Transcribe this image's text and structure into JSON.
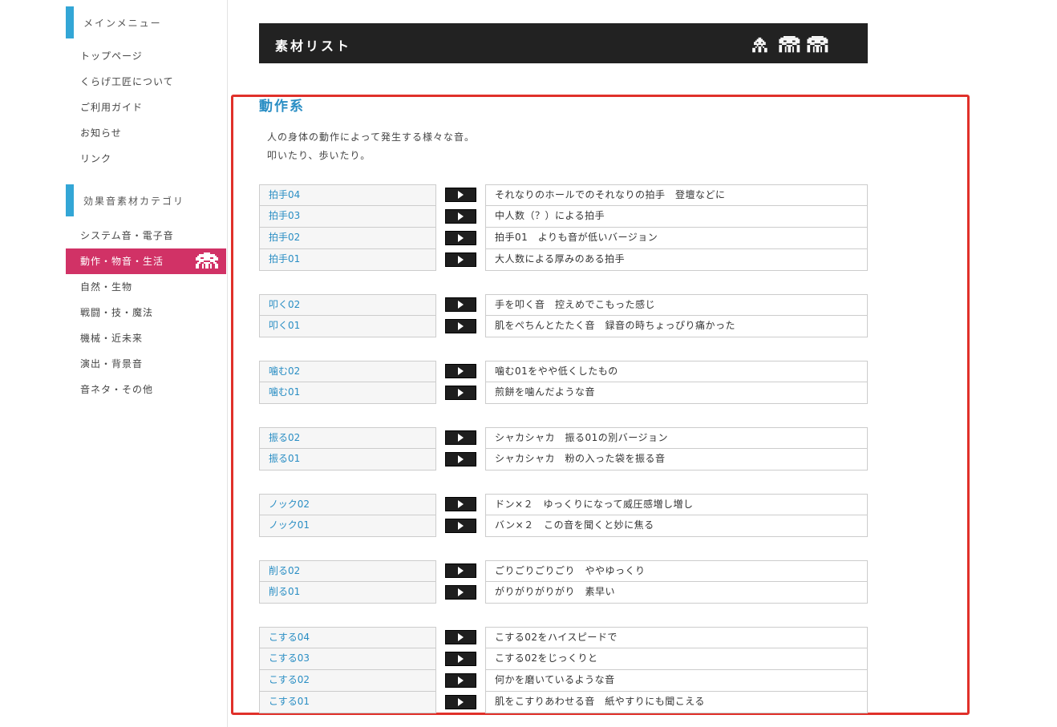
{
  "sidebar": {
    "main_menu": {
      "heading": "メインメニュー",
      "items": [
        {
          "label": "トップページ"
        },
        {
          "label": "くらげ工匠について"
        },
        {
          "label": "ご利用ガイド"
        },
        {
          "label": "お知らせ"
        },
        {
          "label": "リンク"
        }
      ]
    },
    "categories": {
      "heading": "効果音素材カテゴリ",
      "items": [
        {
          "label": "システム音・電子音"
        },
        {
          "label": "動作・物音・生活",
          "active": true
        },
        {
          "label": "自然・生物"
        },
        {
          "label": "戦闘・技・魔法"
        },
        {
          "label": "機械・近未来"
        },
        {
          "label": "演出・背景音"
        },
        {
          "label": "音ネタ・その他"
        }
      ]
    }
  },
  "header": {
    "title": "素材リスト",
    "icon": "space-invader-icon"
  },
  "category": {
    "title": "動作系",
    "desc_line1": "人の身体の動作によって発生する様々な音。",
    "desc_line2": "叩いたり、歩いたり。"
  },
  "colors": {
    "accent_blue": "#33a6d6",
    "active_pink": "#d13266",
    "link_blue": "#2a8ec4",
    "highlight_red": "#e0302a"
  },
  "groups": [
    {
      "sounds": [
        {
          "name": "拍手04",
          "desc": "それなりのホールでのそれなりの拍手　登壇などに"
        },
        {
          "name": "拍手03",
          "desc": "中人数（？）による拍手"
        },
        {
          "name": "拍手02",
          "desc": "拍手01　よりも音が低いバージョン"
        },
        {
          "name": "拍手01",
          "desc": "大人数による厚みのある拍手"
        }
      ]
    },
    {
      "sounds": [
        {
          "name": "叩く02",
          "desc": "手を叩く音　控えめでこもった感じ"
        },
        {
          "name": "叩く01",
          "desc": "肌をぺちんとたたく音　録音の時ちょっぴり痛かった"
        }
      ]
    },
    {
      "sounds": [
        {
          "name": "噛む02",
          "desc": "噛む01をやや低くしたもの"
        },
        {
          "name": "噛む01",
          "desc": "煎餅を噛んだような音"
        }
      ]
    },
    {
      "sounds": [
        {
          "name": "振る02",
          "desc": "シャカシャカ　振る01の別バージョン"
        },
        {
          "name": "振る01",
          "desc": "シャカシャカ　粉の入った袋を振る音"
        }
      ]
    },
    {
      "sounds": [
        {
          "name": "ノック02",
          "desc": "ドン×２　ゆっくりになって威圧感増し増し"
        },
        {
          "name": "ノック01",
          "desc": "バン×２　この音を聞くと妙に焦る"
        }
      ]
    },
    {
      "sounds": [
        {
          "name": "削る02",
          "desc": "ごりごりごりごり　ややゆっくり"
        },
        {
          "name": "削る01",
          "desc": "がりがりがりがり　素早い"
        }
      ]
    },
    {
      "sounds": [
        {
          "name": "こする04",
          "desc": "こする02をハイスピードで"
        },
        {
          "name": "こする03",
          "desc": "こする02をじっくりと"
        },
        {
          "name": "こする02",
          "desc": "何かを磨いているような音"
        },
        {
          "name": "こする01",
          "desc": "肌をこすりあわせる音　紙やすりにも聞こえる"
        }
      ]
    }
  ]
}
